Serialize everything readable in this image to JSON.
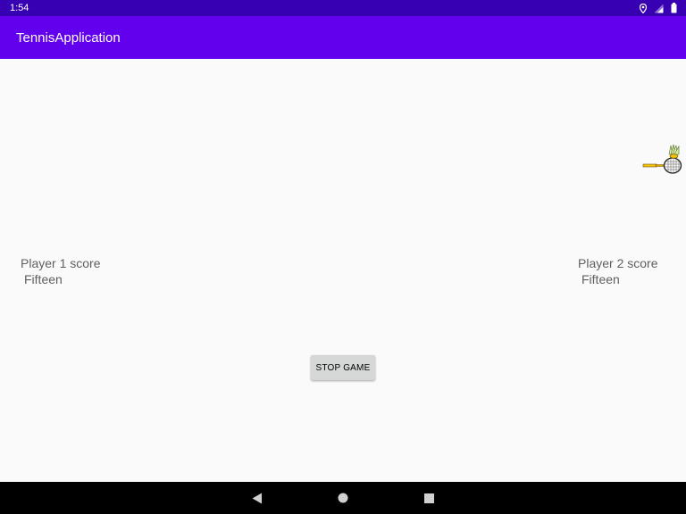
{
  "status_bar": {
    "time": "1:54",
    "icons": [
      "location-icon",
      "signal-icon",
      "battery-icon"
    ]
  },
  "app_bar": {
    "title": "TennisApplication"
  },
  "player1": {
    "label": "Player 1 score",
    "score": "Fifteen"
  },
  "player2": {
    "label": "Player 2 score",
    "score": "Fifteen"
  },
  "game": {
    "stop_button_label": "STOP GAME"
  },
  "colors": {
    "status_bar": "#3700b3",
    "app_bar": "#6200ee",
    "background": "#fafafa",
    "button": "#d6d7d7",
    "nav_bar": "#000000"
  },
  "nav_bar": {
    "icons": [
      "back-icon",
      "home-icon",
      "recents-icon"
    ]
  }
}
